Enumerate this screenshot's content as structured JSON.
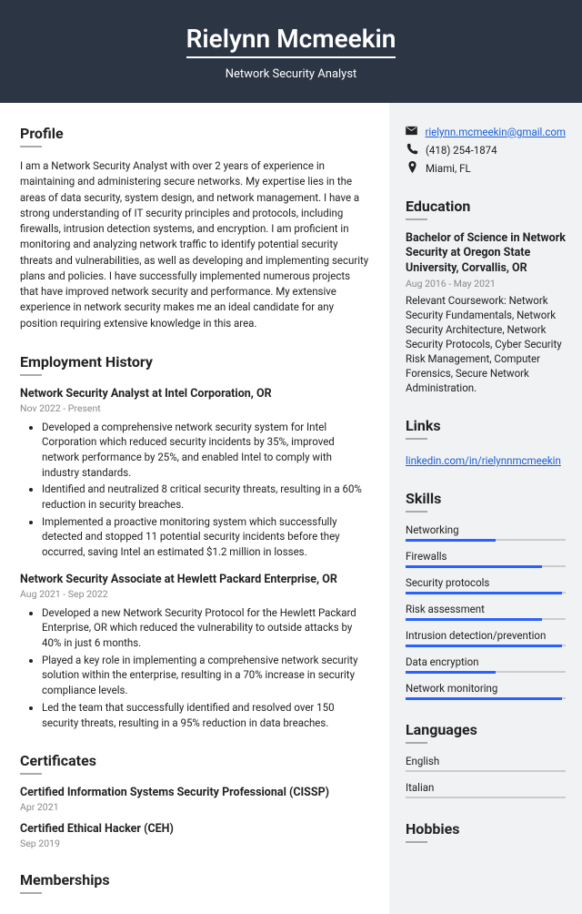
{
  "header": {
    "name": "Rielynn Mcmeekin",
    "subtitle": "Network Security Analyst"
  },
  "profile": {
    "title": "Profile",
    "text": "I am a Network Security Analyst with over 2 years of experience in maintaining and administering secure networks. My expertise lies in the areas of data security, system design, and network management. I have a strong understanding of IT security principles and protocols, including firewalls, intrusion detection systems, and encryption. I am proficient in monitoring and analyzing network traffic to identify potential security threats and vulnerabilities, as well as developing and implementing security plans and policies. I have successfully implemented numerous projects that have improved network security and performance. My extensive experience in network security makes me an ideal candidate for any position requiring extensive knowledge in this area."
  },
  "employment": {
    "title": "Employment History",
    "jobs": [
      {
        "title": "Network Security Analyst at Intel Corporation, OR",
        "dates": "Nov 2022 - Present",
        "bullets": [
          "Developed a comprehensive network security system for Intel Corporation which reduced security incidents by 35%, improved network performance by 25%, and enabled Intel to comply with industry standards.",
          "Identified and neutralized 8 critical security threats, resulting in a 60% reduction in security breaches.",
          "Implemented a proactive monitoring system which successfully detected and stopped 11 potential security incidents before they occurred, saving Intel an estimated $1.2 million in losses."
        ]
      },
      {
        "title": "Network Security Associate at Hewlett Packard Enterprise, OR",
        "dates": "Aug 2021 - Sep 2022",
        "bullets": [
          "Developed a new Network Security Protocol for the Hewlett Packard Enterprise, OR which reduced the vulnerability to outside attacks by 40% in just 6 months.",
          "Played a key role in implementing a comprehensive network security solution within the enterprise, resulting in a 70% increase in security compliance levels.",
          "Led the team that successfully identified and resolved over 150 security threats, resulting in a 95% reduction in data breaches."
        ]
      }
    ]
  },
  "certificates": {
    "title": "Certificates",
    "items": [
      {
        "title": "Certified Information Systems Security Professional (CISSP)",
        "date": "Apr 2021"
      },
      {
        "title": "Certified Ethical Hacker (CEH)",
        "date": "Sep 2019"
      }
    ]
  },
  "memberships": {
    "title": "Memberships"
  },
  "contact": {
    "email": "rielynn.mcmeekin@gmail.com",
    "phone": "(418) 254-1874",
    "location": "Miami, FL"
  },
  "education": {
    "title": "Education",
    "degree": "Bachelor of Science in Network Security at Oregon State University, Corvallis, OR",
    "dates": "Aug 2016 - May 2021",
    "desc": "Relevant Coursework: Network Security Fundamentals, Network Security Architecture, Network Security Protocols, Cyber Security Risk Management, Computer Forensics, Secure Network Administration."
  },
  "links": {
    "title": "Links",
    "url": "linkedin.com/in/rielynnmcmeekin"
  },
  "skills": {
    "title": "Skills",
    "items": [
      {
        "name": "Networking",
        "pct": 56
      },
      {
        "name": "Firewalls",
        "pct": 85
      },
      {
        "name": "Security protocols",
        "pct": 98
      },
      {
        "name": "Risk assessment",
        "pct": 85
      },
      {
        "name": "Intrusion detection/prevention",
        "pct": 98
      },
      {
        "name": "Data encryption",
        "pct": 56
      },
      {
        "name": "Network monitoring",
        "pct": 98
      }
    ]
  },
  "languages": {
    "title": "Languages",
    "items": [
      "English",
      "Italian"
    ]
  },
  "hobbies": {
    "title": "Hobbies"
  }
}
